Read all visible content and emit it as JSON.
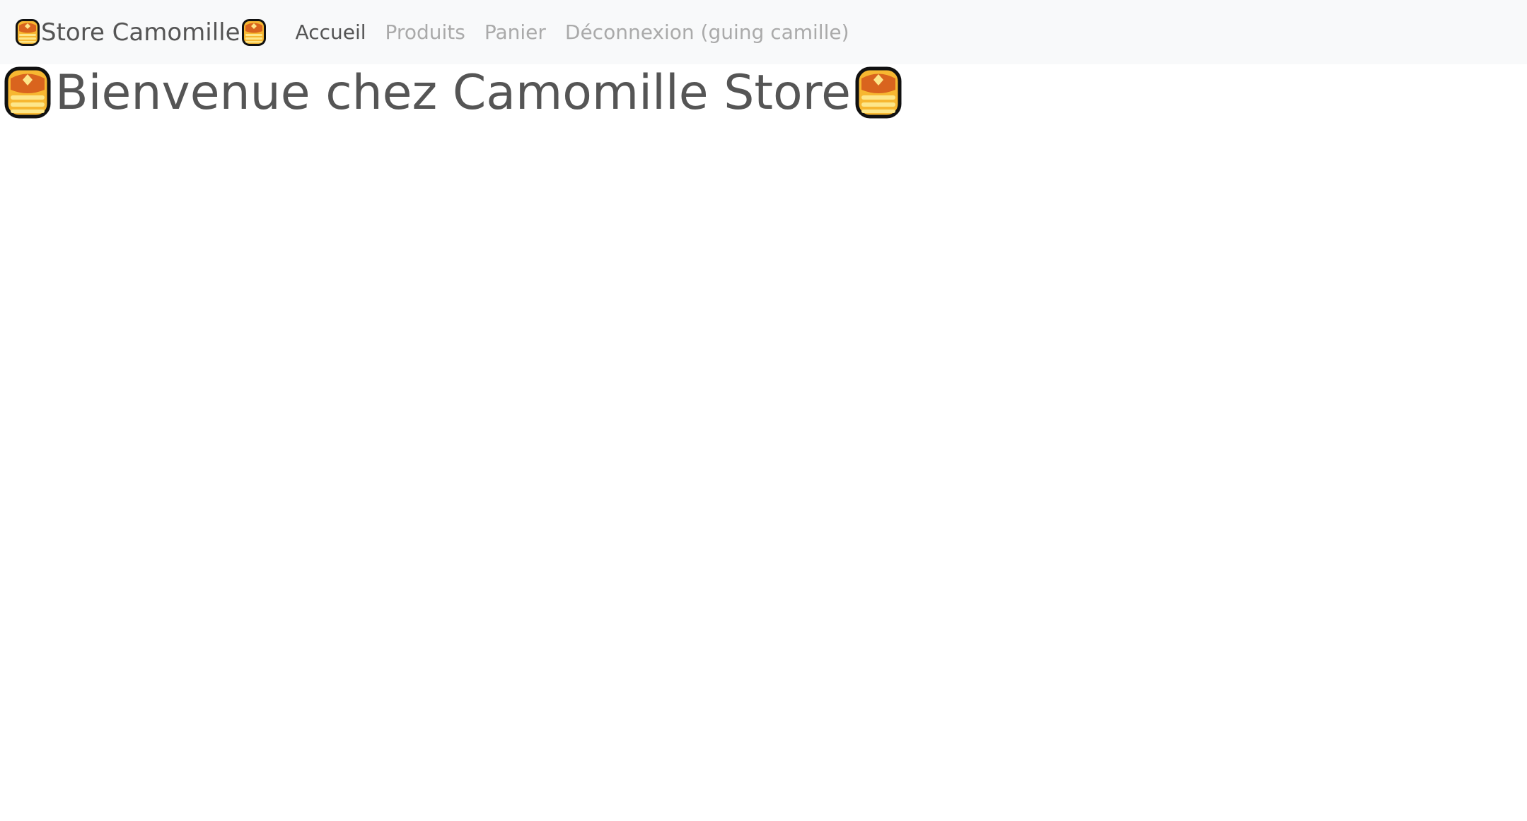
{
  "navbar": {
    "brand_label": "Store Camomille",
    "brand_icon": "pancake-icon",
    "links": [
      {
        "label": "Accueil",
        "active": true
      },
      {
        "label": "Produits",
        "active": false
      },
      {
        "label": "Panier",
        "active": false
      },
      {
        "label": "Déconnexion (guing camille)",
        "active": false
      }
    ]
  },
  "main": {
    "title": "Bienvenue chez Camomille Store",
    "title_icon": "pancake-icon"
  },
  "colors": {
    "navbar_bg": "#f8f9fa",
    "text": "#555555",
    "muted_link": "#aaaaaa"
  }
}
